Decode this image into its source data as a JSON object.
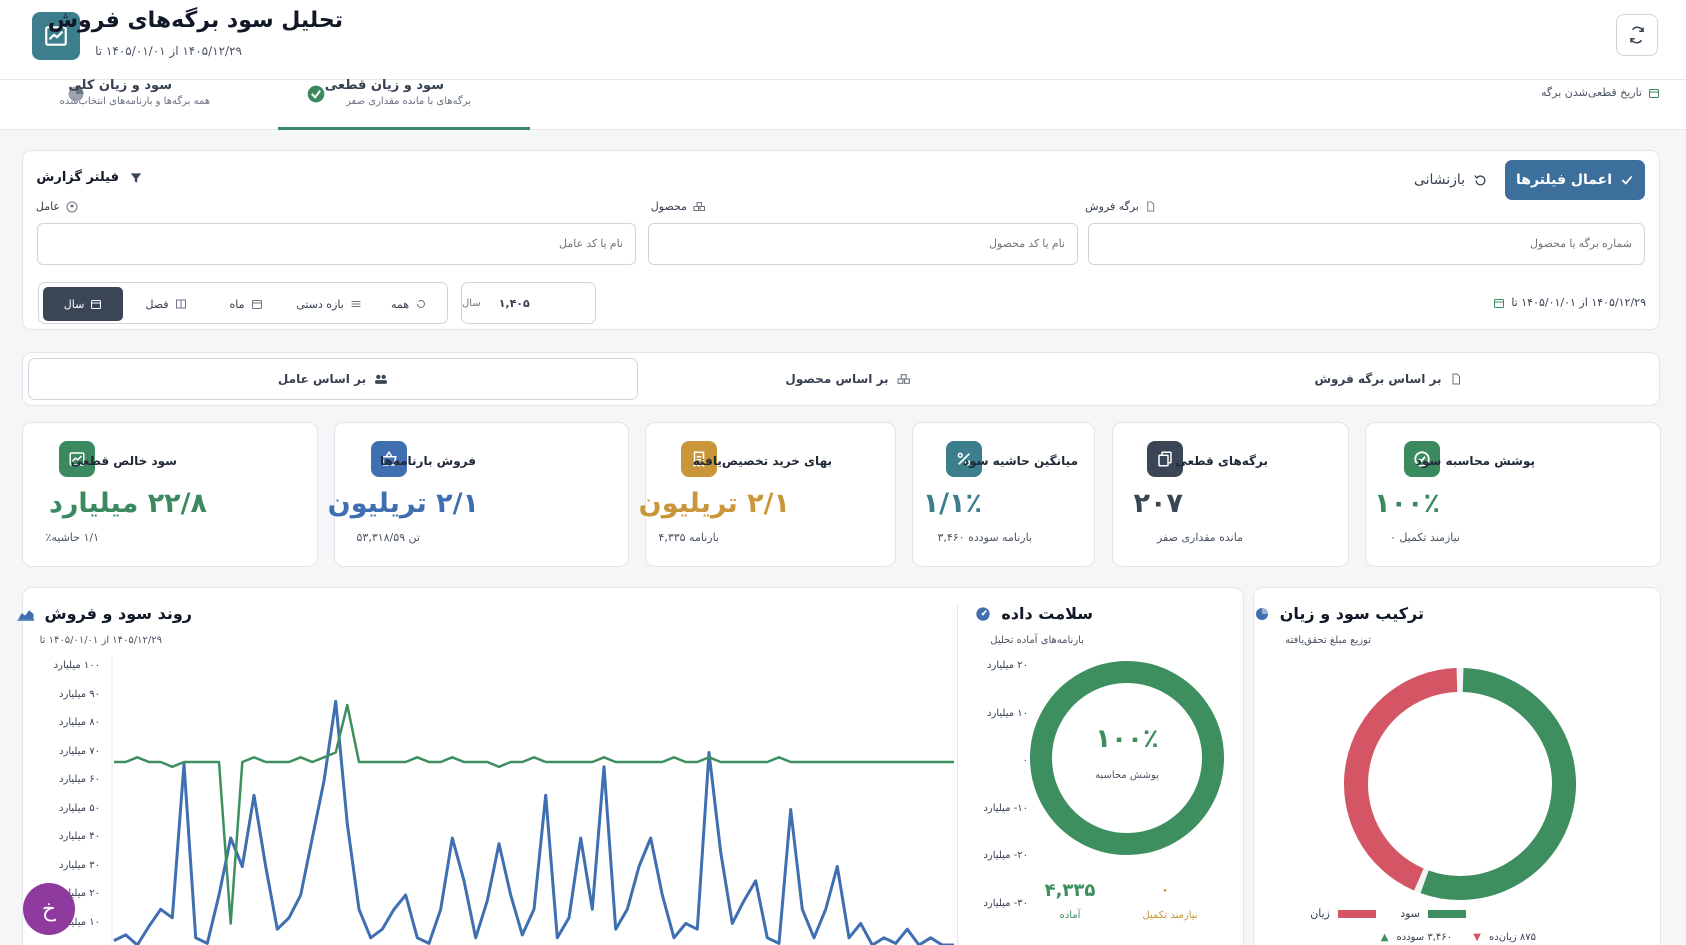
{
  "header": {
    "title": "تحلیل سود برگه‌های فروش",
    "subtitle": "۱۴۰۵/۱۲/۲۹ از ۱۴۰۵/۰۱/۰۱ تا"
  },
  "tabs": [
    {
      "label": "سود و زیان قطعی",
      "sub": "برگه‌های با مانده مقداری صفر",
      "active": true
    },
    {
      "label": "سود و زیان کلی",
      "sub": "همه برگه‌ها و بارنامه‌های انتخاب‌شده",
      "active": false
    }
  ],
  "date_mode_label": "تاریخ قطعی‌شدن برگه",
  "filter": {
    "title": "فیلتر گزارش",
    "apply_label": "اعمال فیلترها",
    "reset_label": "بازنشانی",
    "fields": {
      "sheet": {
        "label": "برگه فروش",
        "placeholder": "شماره برگه یا محصول"
      },
      "product": {
        "label": "محصول",
        "placeholder": "نام یا کد محصول"
      },
      "agent": {
        "label": "عامل",
        "placeholder": "نام یا کد عامل"
      }
    },
    "periods": [
      "سال",
      "فصل",
      "ماه",
      "بازه دستی",
      "همه"
    ],
    "active_period": "سال",
    "year_label": "سال",
    "year_value": "۱,۴۰۵",
    "range_text": "۱۴۰۵/۱۲/۲۹ از ۱۴۰۵/۰۱/۰۱ تا"
  },
  "view_tabs": [
    "بر اساس برگه فروش",
    "بر اساس محصول",
    "بر اساس عامل"
  ],
  "active_view": "بر اساس عامل",
  "kpis": [
    {
      "label": "پوشش محاسبه سود",
      "value": "۱۰۰٪",
      "sub": "نیازمند تکمیل ۰",
      "color": "#3b8a5f",
      "icon": "check-circle-icon"
    },
    {
      "label": "برگه‌های قطعی",
      "value": "۲۰۷",
      "sub": "مانده مقداری صفر",
      "color": "#3a4656",
      "icon": "documents-icon"
    },
    {
      "label": "میانگین حاشیه سود",
      "value": "۱/۱٪",
      "sub": "بارنامه سودده ۳,۴۶۰",
      "color": "#3d7e8d",
      "icon": "percent-icon"
    },
    {
      "label": "بهای خرید تخصیص‌یافته",
      "value": "۲/۱ تریلیون",
      "sub": "بارنامه ۴,۳۳۵",
      "color": "#c9973a",
      "icon": "receipt-icon"
    },
    {
      "label": "فروش بارنامه‌ها",
      "value": "۲/۱ تریلیون",
      "sub": "تن ۵۳,۳۱۸/۵۹",
      "color": "#3f6fb0",
      "icon": "basket-icon"
    },
    {
      "label": "سود خالص قطعی",
      "value": "۲۲/۸ میلیارد",
      "sub": "۱/۱ حاشیه٪",
      "color": "#3b8a5f",
      "icon": "trend-icon"
    }
  ],
  "composition": {
    "title": "ترکیب سود و زیان",
    "sub": "توزیع مبلغ تحقق‌یافته",
    "legend_profit": "سود",
    "legend_loss": "زیان",
    "profit_count": "۳,۴۶۰ سودده",
    "loss_count": "۸۷۵ زیان‌ده",
    "profit_share": 0.56,
    "profit_color": "#3d8f5f",
    "loss_color": "#d45563"
  },
  "health": {
    "title": "سلامت داده",
    "sub": "بارنامه‌های آماده تحلیل",
    "center_value": "۱۰۰٪",
    "center_label": "پوشش محاسبه",
    "ready_value": "۴,۳۳۵",
    "ready_label": "آماده",
    "incomplete_value": "۰",
    "incomplete_label": "نیازمند تکمیل",
    "coverage": 1.0,
    "ring_color": "#3d8f5f"
  },
  "trend": {
    "title": "روند سود و فروش",
    "sub": "۱۴۰۵/۱۲/۲۹ از ۱۴۰۵/۰۱/۰۱ تا",
    "left_ticks": [
      "۱۰۰ میلیارد",
      "۹۰ میلیارد",
      "۸۰ میلیارد",
      "۷۰ میلیارد",
      "۶۰ میلیارد",
      "۵۰ میلیارد",
      "۴۰ میلیارد",
      "۳۰ میلیارد",
      "۲۰ میلیارد",
      "۱۰ میلیارد"
    ],
    "right_ticks": [
      "۲۰ میلیارد",
      "۱۰ میلیارد",
      "۰",
      "۱۰- میلیارد",
      "۲۰- میلیارد",
      "۳۰- میلیارد"
    ]
  },
  "chart_data": {
    "type": "line",
    "title": "روند سود و فروش",
    "left_ylim": [
      0,
      100
    ],
    "right_ylim": [
      -30,
      20
    ],
    "series": [
      {
        "color": "#3f6fb0",
        "axis": "left",
        "values": [
          4,
          6,
          2,
          9,
          15,
          12,
          66,
          5,
          3,
          20,
          40,
          30,
          55,
          30,
          8,
          12,
          20,
          40,
          60,
          88,
          45,
          15,
          5,
          8,
          15,
          20,
          5,
          3,
          15,
          40,
          25,
          5,
          18,
          38,
          20,
          6,
          15,
          55,
          5,
          12,
          40,
          15,
          65,
          8,
          15,
          30,
          40,
          20,
          5,
          10,
          8,
          70,
          35,
          10,
          18,
          25,
          5,
          3,
          50,
          15,
          5,
          15,
          30,
          5,
          10,
          2,
          5,
          3,
          8,
          2,
          5,
          1,
          2
        ]
      },
      {
        "color": "#3d8f5f",
        "axis": "right",
        "values": [
          0,
          0,
          1,
          0,
          0,
          -1,
          0,
          0,
          0,
          0,
          -34,
          0,
          1,
          0,
          0,
          0,
          1,
          0,
          1,
          2,
          12,
          0,
          0,
          0,
          0,
          0,
          1,
          0,
          0,
          1,
          0,
          0,
          0,
          -1,
          0,
          0,
          1,
          0,
          0,
          0,
          0,
          0,
          1,
          0,
          0,
          0,
          0,
          0,
          1,
          0,
          0,
          1,
          0,
          0,
          0,
          0,
          0,
          1,
          0,
          0,
          0,
          0,
          0,
          0,
          0,
          0,
          0,
          0,
          0,
          0,
          0,
          0,
          0
        ]
      }
    ]
  },
  "fab_label": "خ"
}
